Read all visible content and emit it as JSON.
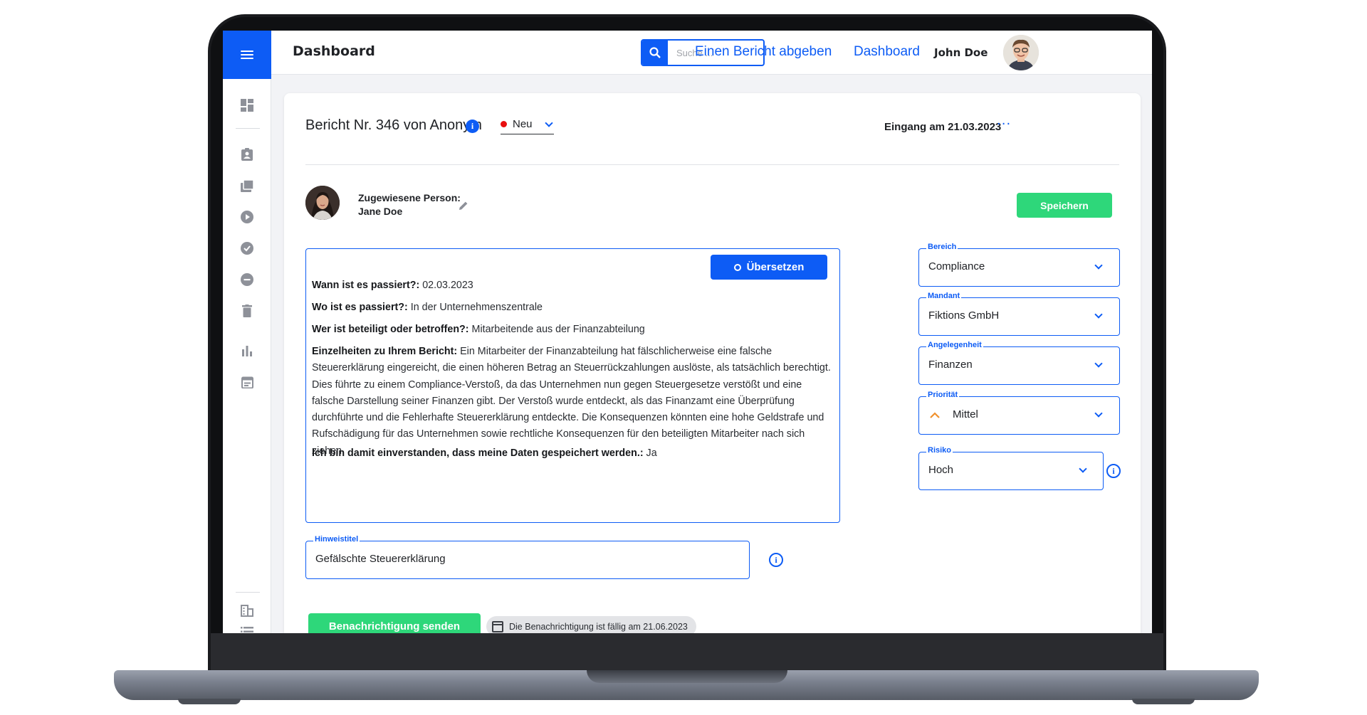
{
  "topbar": {
    "page_title": "Dashboard",
    "search_placeholder": "Suche ...",
    "nav_report": "Einen Bericht abgeben",
    "nav_dashboard": "Dashboard",
    "user_name": "John Doe"
  },
  "sidebar": {
    "icons": [
      "menu-icon",
      "dashboard-icon",
      "assignment-icon",
      "folder-icon",
      "play-circle-icon",
      "check-circle-icon",
      "minus-circle-icon",
      "trash-icon",
      "bar-chart-icon",
      "calendar-icon",
      "building-icon",
      "list-icon"
    ]
  },
  "report": {
    "title": "Bericht Nr. 346 von Anonym",
    "status": "Neu",
    "status_color": "#e80e0e",
    "received": "Eingang am 21.03.2023",
    "assignee_label": "Zugewiesene Person:",
    "assignee_name": "Jane Doe",
    "save_label": "Speichern",
    "translate_label": "Übersetzen",
    "qa": [
      {
        "q": "Wann ist es passiert?:",
        "a": " 02.03.2023"
      },
      {
        "q": "Wo ist es passiert?:",
        "a": " In der Unternehmenszentrale"
      },
      {
        "q": "Wer ist beteiligt oder betroffen?:",
        "a": " Mitarbeitende aus der Finanzabteilung"
      },
      {
        "q": "Einzelheiten zu Ihrem Bericht:",
        "a": " Ein Mitarbeiter der Finanzabteilung hat fälschlicherweise eine falsche Steuererklärung eingereicht, die einen höheren Betrag an Steuerrückzahlungen auslöste, als tatsächlich berechtigt. Dies führte zu einem Compliance-Verstoß, da das Unternehmen nun gegen Steuergesetze verstößt und eine falsche Darstellung seiner Finanzen gibt. Der Verstoß wurde entdeckt, als das Finanzamt eine Überprüfung durchführte und die Fehlerhafte Steuererklärung entdeckte. Die Konsequenzen könnten eine hohe Geldstrafe und Rufschädigung für das Unternehmen sowie rechtliche Konsequenzen für den beteiligten Mitarbeiter nach sich ziehen."
      },
      {
        "q": "Ich bin damit einverstanden, dass meine Daten gespeichert werden.:",
        "a": " Ja"
      }
    ],
    "hint_title_label": "Hinweistitel",
    "hint_title_value": "Gefälschte Steuererklärung",
    "notify_label": "Benachrichtigung senden",
    "due_text": "Die Benachrichtigung ist fällig am 21.06.2023"
  },
  "fields": {
    "bereich": {
      "label": "Bereich",
      "value": "Compliance"
    },
    "mandant": {
      "label": "Mandant",
      "value": "Fiktions GmbH"
    },
    "angelegenheit": {
      "label": "Angelegenheit",
      "value": "Finanzen"
    },
    "prioritaet": {
      "label": "Priorität",
      "value": "Mittel",
      "color": "#f0902c"
    },
    "risiko": {
      "label": "Risiko",
      "value": "Hoch"
    }
  },
  "colors": {
    "accent": "#0d5cf5",
    "success": "#2ed77a"
  }
}
